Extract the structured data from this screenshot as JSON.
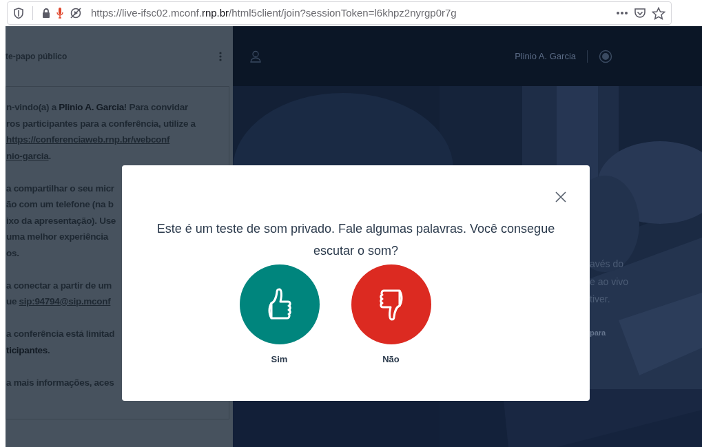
{
  "browser": {
    "url": "https://live-ifsc02.mconf.**rnp.br**/html5client/join?sessionToken=l6khpz2nyrgp0r7g"
  },
  "chat": {
    "title": "te-papo público",
    "paragraphs": [
      [
        [
          {
            "kind": "text",
            "text": "n-vindo(a) a "
          },
          {
            "kind": "bold",
            "text": "Plinio A. Garcia"
          },
          {
            "kind": "text",
            "text": "! Para convidar"
          }
        ],
        [
          {
            "kind": "text",
            "text": "ros participantes para a conferência, utilize a"
          }
        ],
        [
          {
            "kind": "link",
            "text": "https://conferenciaweb.rnp.br/webconf"
          }
        ],
        [
          {
            "kind": "link",
            "text": "nio-garcia"
          },
          {
            "kind": "text",
            "text": "."
          }
        ]
      ],
      [
        [
          {
            "kind": "text",
            "text": "a compartilhar o seu micr"
          }
        ],
        [
          {
            "kind": "text",
            "text": "ão com um telefone (na b"
          }
        ],
        [
          {
            "kind": "text",
            "text": "ixo da apresentação). Use"
          }
        ],
        [
          {
            "kind": "text",
            "text": "uma melhor experiência"
          }
        ],
        [
          {
            "kind": "text",
            "text": "os."
          }
        ]
      ],
      [
        [
          {
            "kind": "text",
            "text": "a conectar a partir de um"
          }
        ],
        [
          {
            "kind": "text",
            "text": "ue "
          },
          {
            "kind": "link",
            "text": "sip:94794@sip.mconf"
          }
        ]
      ],
      [
        [
          {
            "kind": "text",
            "text": "a conferência está limitad"
          }
        ],
        [
          {
            "kind": "bold",
            "text": "ticipantes"
          },
          {
            "kind": "text",
            "text": "."
          }
        ]
      ],
      [
        [
          {
            "kind": "text",
            "text": "a mais informações, aces"
          }
        ]
      ]
    ]
  },
  "top_bar": {
    "user_name": "Plinio A. Garcia"
  },
  "background_texts": [
    {
      "kind": "text",
      "text": "avés do"
    },
    {
      "kind": "text",
      "text": "e ao vivo"
    },
    {
      "kind": "text",
      "text": "tiver."
    },
    {
      "kind": "gap"
    },
    {
      "kind": "bold",
      "text": "para"
    }
  ],
  "dialog": {
    "message": "Este é um teste de som privado. Fale algumas palavras. Você consegue escutar o som?",
    "buttons": [
      {
        "kind": "yes",
        "label": "Sim"
      },
      {
        "kind": "no",
        "label": "Não"
      }
    ]
  }
}
